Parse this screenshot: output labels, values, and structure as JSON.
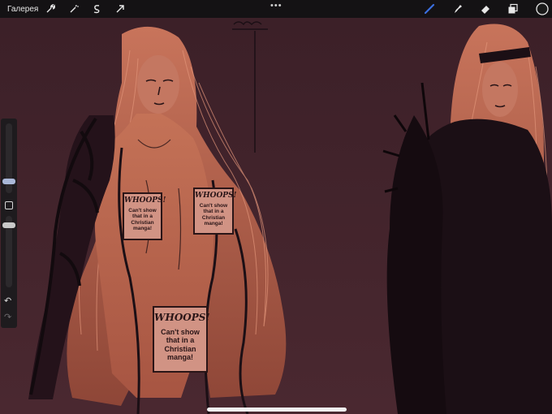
{
  "toolbar": {
    "gallery_label": "Галерея",
    "more_icon": "•••",
    "left_tools": [
      "wrench-icon",
      "magic-wand-icon",
      "selection-s-icon",
      "transform-arrow-icon"
    ],
    "right_tools": [
      "brush-icon",
      "smudge-icon",
      "eraser-icon",
      "layers-icon",
      "color-circle-icon"
    ],
    "active_tool_color": "#3b6fe0",
    "current_color": "#1a1a1a"
  },
  "sidebar": {
    "undo_icon": "↶",
    "redo_icon": "↷"
  },
  "stickers": [
    {
      "title": "WHOOPS!",
      "text": "Can't show that in a Christian manga!"
    },
    {
      "title": "WHOOPS!",
      "text": "Can't show that in a Christian manga!"
    },
    {
      "title": "WHOOPS!",
      "text": "Can't show that in a Christian manga!"
    }
  ],
  "colors": {
    "background": "#40222a",
    "figure_skin": "#b9654a",
    "line_art": "#1b0f15",
    "sticker_bg": "#d19384"
  }
}
